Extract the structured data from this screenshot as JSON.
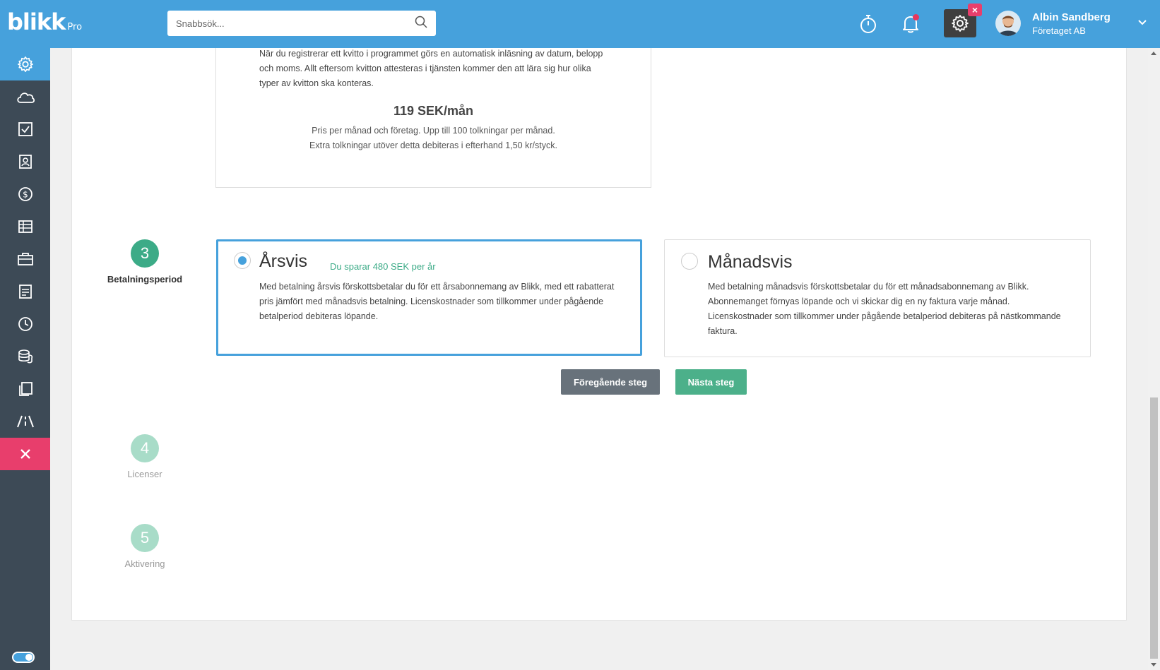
{
  "app": {
    "logo_text": "blikk",
    "logo_suffix": "Pro"
  },
  "header": {
    "search_placeholder": "Snabbsök...",
    "user_name": "Albin Sandberg",
    "company": "Företaget AB",
    "accent_color": "#46a1dc"
  },
  "sidebar": {
    "items": [
      {
        "icon": "gear-icon",
        "active": true
      },
      {
        "icon": "cloud-icon"
      },
      {
        "icon": "checkbox-icon"
      },
      {
        "icon": "contact-card-icon"
      },
      {
        "icon": "dollar-icon"
      },
      {
        "icon": "table-icon"
      },
      {
        "icon": "briefcase-icon"
      },
      {
        "icon": "document-list-icon"
      },
      {
        "icon": "clock-icon"
      },
      {
        "icon": "coins-icon"
      },
      {
        "icon": "copy-icon"
      },
      {
        "icon": "road-icon"
      },
      {
        "icon": "close-icon",
        "highlight": true
      }
    ]
  },
  "previous_service": {
    "description": "När du registrerar ett kvitto i programmet görs en automatisk inläsning av datum, belopp och moms. Allt eftersom kvitton attesteras i tjänsten kommer den att lära sig hur olika typer av kvitton ska konteras.",
    "price": "119 SEK/mån",
    "price_note_1": "Pris per månad och företag. Upp till 100 tolkningar per månad.",
    "price_note_2": "Extra tolkningar utöver detta debiteras i efterhand 1,50 kr/styck."
  },
  "steps": [
    {
      "number": "3",
      "label": "Betalningsperiod",
      "state": "active"
    },
    {
      "number": "4",
      "label": "Licenser",
      "state": "todo"
    },
    {
      "number": "5",
      "label": "Aktivering",
      "state": "todo"
    }
  ],
  "payment_options": {
    "yearly": {
      "title": "Årsvis",
      "saving": "Du sparar 480 SEK per år",
      "description": "Med betalning årsvis förskottsbetalar du för ett årsabonnemang av Blikk, med ett rabatterat pris jämfört med månadsvis betalning. Licenskostnader som tillkommer under pågående betalperiod debiteras löpande.",
      "selected": true
    },
    "monthly": {
      "title": "Månadsvis",
      "description": "Med betalning månadsvis förskottsbetalar du för ett månadsabonnemang av Blikk. Abonnemanget förnyas löpande och vi skickar dig en ny faktura varje månad. Licenskostnader som tillkommer under pågående betalperiod debiteras på nästkommande faktura.",
      "selected": false
    }
  },
  "buttons": {
    "previous": "Föregående steg",
    "next": "Nästa steg"
  }
}
